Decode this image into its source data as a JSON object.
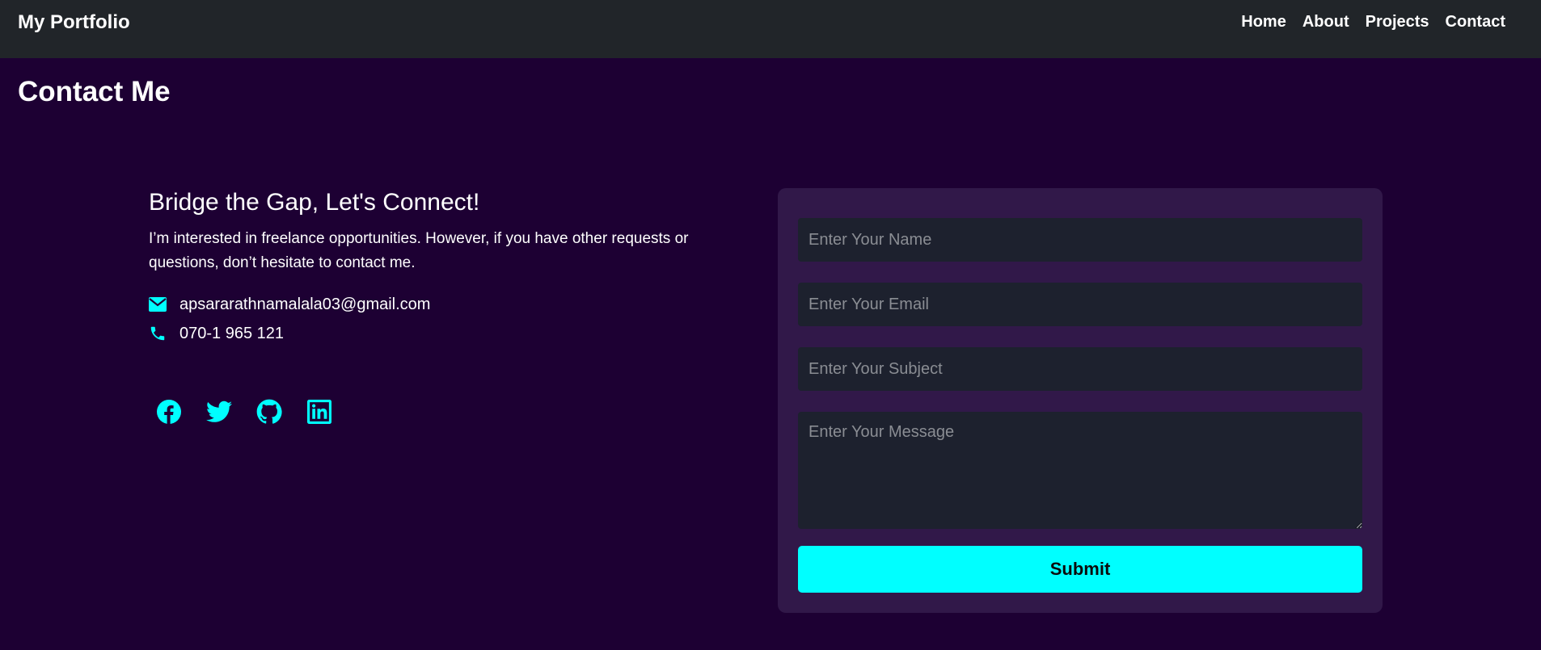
{
  "nav": {
    "brand": "My Portfolio",
    "links": [
      "Home",
      "About",
      "Projects",
      "Contact"
    ]
  },
  "page": {
    "title": "Contact Me"
  },
  "info": {
    "heading": "Bridge the Gap, Let's Connect!",
    "text": "I’m interested in freelance opportunities. However, if you have other requests or questions, don’t hesitate to contact me.",
    "email": "apsararathnamalala03@gmail.com",
    "phone": "070-1 965 121"
  },
  "socials": [
    "facebook-icon",
    "twitter-icon",
    "github-icon",
    "linkedin-icon"
  ],
  "form": {
    "name_placeholder": "Enter Your Name",
    "email_placeholder": "Enter Your Email",
    "subject_placeholder": "Enter Your Subject",
    "message_placeholder": "Enter Your Message",
    "submit_label": "Submit"
  },
  "colors": {
    "background": "#1d0033",
    "navbar": "#212529",
    "accent": "#00ffff",
    "card": "#311849",
    "input": "#1d212e"
  }
}
